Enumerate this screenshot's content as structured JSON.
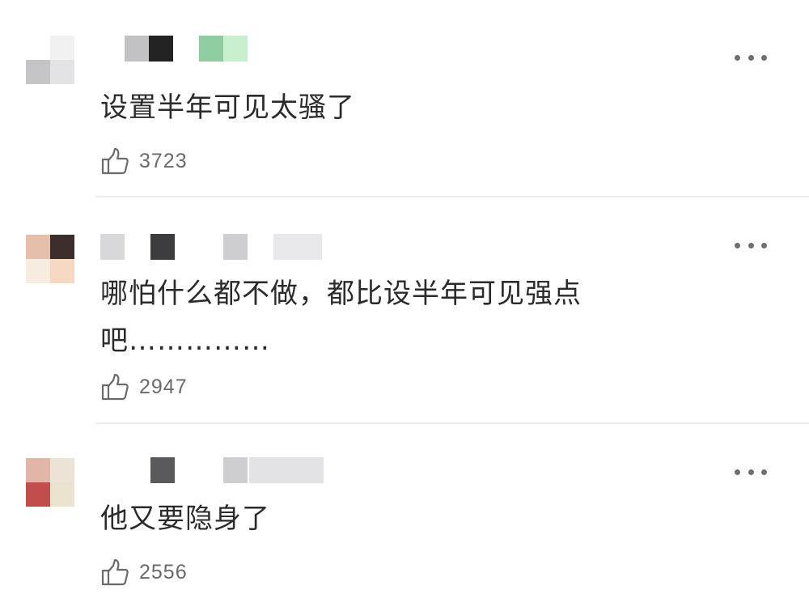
{
  "comments": [
    {
      "text": "设置半年可见太骚了",
      "likes": "3723",
      "avatar_colors": [
        "#ffffff",
        "#f1f1f1",
        "#c5c5c7",
        "#e3e3e6"
      ],
      "name_colors": [
        "#c2c2c4",
        "#222222",
        "#8fcc9f",
        "#c8f0cf"
      ]
    },
    {
      "text": "哪怕什么都不做，都比设半年可见强点吧……………",
      "likes": "2947",
      "avatar_colors": [
        "#e6bfaa",
        "#3a2d2b",
        "#f6ecdf",
        "#f7d8c2"
      ],
      "name_colors": [
        "#d8d8da",
        "#3d3d3f",
        "#cfcfd1",
        "#e9e9eb"
      ]
    },
    {
      "text": "他又要隐身了",
      "likes": "2556",
      "avatar_colors": [
        "#e1b6a8",
        "#ece5d7",
        "#c24d4d",
        "#e9e3cf"
      ],
      "name_colors": [
        "#59595b",
        "#cfcfd1",
        "#e3e3e5"
      ]
    }
  ],
  "icons": {
    "like": "thumbs-up-icon",
    "more": "more-dots-icon"
  }
}
